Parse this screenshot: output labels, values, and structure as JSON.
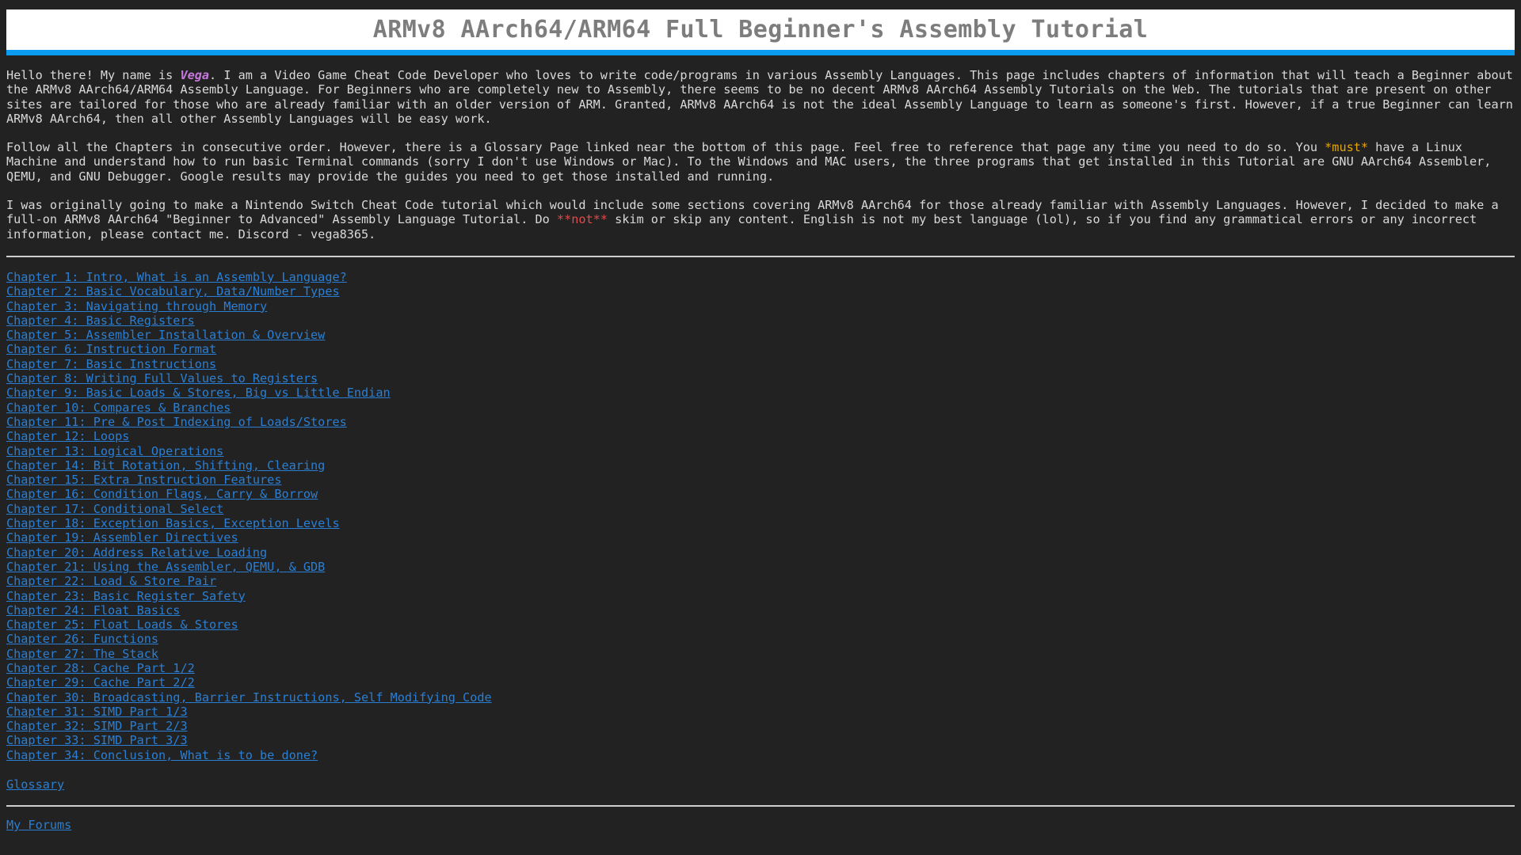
{
  "page": {
    "title": "ARMv8 AArch64/ARM64 Full Beginner's Assembly Tutorial",
    "background_color": "#222222",
    "text_color": "#d9d9d9",
    "link_color": "#2a7fd4",
    "accent_color": "#0b9bf0",
    "title_color": "#7d7d7d"
  },
  "intro": {
    "paragraph1": {
      "part1": "Hello there! My name is ",
      "highlight": "Vega",
      "part2": ". I am a Video Game Cheat Code Developer who loves to write code/programs in various Assembly Languages. This page includes chapters of information that will teach a Beginner about the ARMv8 AArch64/ARM64 Assembly Language. For Beginners who are completely new to Assembly, there seems to be no decent ARMv8 AArch64 Assembly Tutorials on the Web. The tutorials that are present on other sites are tailored for those who are already familiar with an older version of ARM. Granted, ARMv8 AArch64 is not the ideal Assembly Language to learn as someone's first. However, if a true Beginner can learn ARMv8 AArch64, then all other Assembly Languages will be easy work."
    },
    "paragraph2": {
      "part1": "Follow all the Chapters in consecutive order. However, there is a Glossary Page linked near the bottom of this page. Feel free to reference that page any time you need to do so. You ",
      "highlight": "*must*",
      "part2": " have a Linux Machine and understand how to run basic Terminal commands (sorry I don't use Windows or Mac). To the Windows and MAC users, the three programs that get installed in this Tutorial are GNU AArch64 Assembler, QEMU, and GNU Debugger. Google results may provide the guides you need to get those installed and running."
    },
    "paragraph3": {
      "part1": "I was originally going to make a Nintendo Switch Cheat Code tutorial which would include some sections covering ARMv8 AArch64 for those already familiar with Assembly Languages. However, I decided to make a full-on ARMv8 AArch64 \"Beginner to Advanced\" Assembly Language Tutorial. Do ",
      "highlight": "**not**",
      "part2": " skim or skip any content. English is not my best language (lol), so if you find any grammatical errors or any incorrect information, please contact me. Discord - vega8365."
    }
  },
  "chapters": [
    "Chapter 1: Intro, What is an Assembly Language?",
    "Chapter 2: Basic Vocabulary, Data/Number Types",
    "Chapter 3: Navigating through Memory",
    "Chapter 4: Basic Registers",
    "Chapter 5: Assembler Installation & Overview",
    "Chapter 6: Instruction Format",
    "Chapter 7: Basic Instructions",
    "Chapter 8: Writing Full Values to Registers",
    "Chapter 9: Basic Loads & Stores, Big vs Little Endian",
    "Chapter 10: Compares & Branches",
    "Chapter 11: Pre & Post Indexing of Loads/Stores",
    "Chapter 12: Loops",
    "Chapter 13: Logical Operations",
    "Chapter 14: Bit Rotation, Shifting, Clearing",
    "Chapter 15: Extra Instruction Features",
    "Chapter 16: Condition Flags, Carry & Borrow",
    "Chapter 17: Conditional Select",
    "Chapter 18: Exception Basics, Exception Levels",
    "Chapter 19: Assembler Directives",
    "Chapter 20: Address Relative Loading",
    "Chapter 21: Using the Assembler, QEMU, & GDB",
    "Chapter 22: Load & Store Pair",
    "Chapter 23: Basic Register Safety",
    "Chapter 24: Float Basics",
    "Chapter 25: Float Loads & Stores",
    "Chapter 26: Functions",
    "Chapter 27: The Stack",
    "Chapter 28: Cache Part 1/2",
    "Chapter 29: Cache Part 2/2",
    "Chapter 30: Broadcasting, Barrier Instructions, Self Modifying Code",
    "Chapter 31: SIMD Part 1/3",
    "Chapter 32: SIMD Part 2/3",
    "Chapter 33: SIMD Part 3/3",
    "Chapter 34: Conclusion, What is to be done?"
  ],
  "glossary_link": "Glossary",
  "forums_link": "My Forums"
}
